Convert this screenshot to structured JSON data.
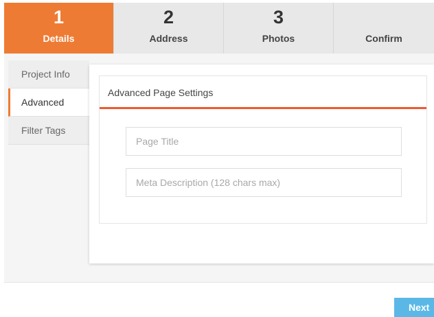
{
  "steps": [
    {
      "number": "1",
      "label": "Details",
      "active": true
    },
    {
      "number": "2",
      "label": "Address"
    },
    {
      "number": "3",
      "label": "Photos"
    },
    {
      "number": "",
      "label": "Confirm"
    }
  ],
  "sidebar": {
    "items": [
      {
        "label": "Project Info"
      },
      {
        "label": "Advanced",
        "active": true
      },
      {
        "label": "Filter Tags"
      }
    ]
  },
  "card": {
    "title": "Advanced Page Settings",
    "page_title_placeholder": "Page Title",
    "meta_description_placeholder": "Meta Description (128 chars max)"
  },
  "footer": {
    "next_label": "Next"
  },
  "colors": {
    "accent": "#ee7b33",
    "underline": "#ee5a30",
    "next_button": "#5bb8e6"
  }
}
